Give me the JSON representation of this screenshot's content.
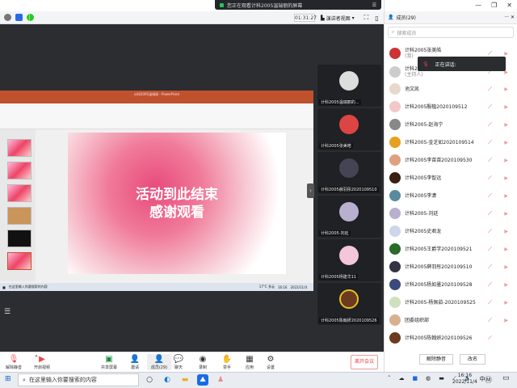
{
  "notice": "您正在观看计科2005温瑞丽的屏幕",
  "timer": "01:31:27",
  "view_mode": "演讲者视图",
  "share": {
    "ppt_title": "计科2005温瑞丽 - PowerPoint",
    "slide_line1": "活动到此结束",
    "slide_line2": "感谢观看",
    "weather": "17°C 多云",
    "time": "16:16",
    "date": "2022/11/4",
    "search_placeholder": "在这里输入你要搜索的内容"
  },
  "videos": [
    {
      "name": "计科2005温瑞丽的...",
      "color": "#ddd"
    },
    {
      "name": "计科2005张美皓",
      "color": "#d44"
    },
    {
      "name": "计科2005薛羽彤2020109510",
      "color": "#445"
    },
    {
      "name": "计科2005-刘廷",
      "color": "#b9b0d0"
    },
    {
      "name": "计科2005杨建华11",
      "color": "#f3c6d8"
    },
    {
      "name": "计科2005陈翰妍2020109526",
      "color": "#6b3a1f"
    }
  ],
  "toolbar": {
    "unmute": "解除静音",
    "video": "开启视频",
    "share": "共享屏幕",
    "invite": "邀请",
    "members": "成员(29)",
    "chat": "聊天",
    "record": "录制",
    "raise_hand": "举手",
    "apps": "应用",
    "settings": "设置",
    "leave": "离开会议"
  },
  "panel": {
    "title": "成员(29)",
    "search_placeholder": "搜索成员",
    "speaking": "正在讲话:",
    "unmute_all": "解除静音",
    "rename": "改名",
    "members": [
      {
        "name": "计科2005张美皓",
        "sub": "(我)",
        "color": "#c33"
      },
      {
        "name": "计科2005温瑞丽",
        "sub": "(主持人)",
        "color": "#ccc"
      },
      {
        "name": "池文凯",
        "sub": "",
        "color": "#e8d8cc"
      },
      {
        "name": "计科2005殷植2020109512",
        "sub": "",
        "color": "#f2c8cc"
      },
      {
        "name": "计科2005-赵海宁",
        "sub": "",
        "color": "#888"
      },
      {
        "name": "计科2005-金芝如2020109514",
        "sub": "",
        "color": "#e6a020"
      },
      {
        "name": "计科2005李苗苗2020109530",
        "sub": "",
        "color": "#e0a080"
      },
      {
        "name": "计科2005李智远",
        "sub": "",
        "color": "#3a2010"
      },
      {
        "name": "计科2005李潇",
        "sub": "",
        "color": "#5a8aa0"
      },
      {
        "name": "计科2005-刘廷",
        "sub": "",
        "color": "#b9b0d0"
      },
      {
        "name": "计科2005史君龙",
        "sub": "",
        "color": "#cdd6ea"
      },
      {
        "name": "计科2005王爵学2020109521",
        "sub": "",
        "color": "#2a6a2a"
      },
      {
        "name": "计科2005薛羽彤2020109510",
        "sub": "",
        "color": "#334"
      },
      {
        "name": "计科2005杨如墨2020109528",
        "sub": "",
        "color": "#3a4a7a"
      },
      {
        "name": "计科2005-杨佩茹-2020109525",
        "sub": "",
        "color": "#cfe0c0"
      },
      {
        "name": "团委组织部",
        "sub": "",
        "color": "#d8b090"
      },
      {
        "name": "计科2005陈翰妍2020109526",
        "sub": "",
        "color": "#6b3a1f"
      }
    ]
  },
  "taskbar": {
    "search_placeholder": "在这里输入你要搜索的内容",
    "ime": "中",
    "time": "16:16",
    "date": "2022/11/4"
  }
}
